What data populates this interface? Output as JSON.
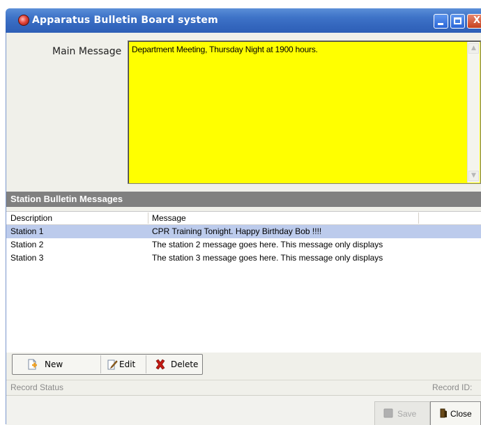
{
  "window": {
    "title": "Apparatus Bulletin Board system",
    "icon": "app-icon",
    "controls": {
      "minimize": "minimize",
      "maximize": "maximize",
      "close": "X"
    }
  },
  "main_message": {
    "label": "Main Message",
    "value": "Department Meeting, Thursday Night at 1900 hours.",
    "background": "#ffff00"
  },
  "station_section": {
    "title": "Station Bulletin Messages",
    "columns": [
      "Description",
      "Message"
    ],
    "rows": [
      {
        "description": "Station 1",
        "message": "CPR Training Tonight.   Happy Birthday Bob !!!!",
        "selected": true
      },
      {
        "description": "Station 2",
        "message": "The station 2 message goes here.  This message only displays",
        "selected": false
      },
      {
        "description": "Station 3",
        "message": "The station 3 message goes here.  This message only displays",
        "selected": false
      }
    ],
    "selected_color": "#bccbec"
  },
  "toolbar": {
    "new_label": "New",
    "edit_label": "Edit",
    "delete_label": "Delete"
  },
  "status": {
    "record_status_label": "Record Status",
    "record_id_label": "Record ID:"
  },
  "footer": {
    "save_label": "Save",
    "close_label": "Close"
  },
  "colors": {
    "titlebar": "#3467be",
    "section_header": "#808080",
    "window_body": "#f0f0ea"
  }
}
